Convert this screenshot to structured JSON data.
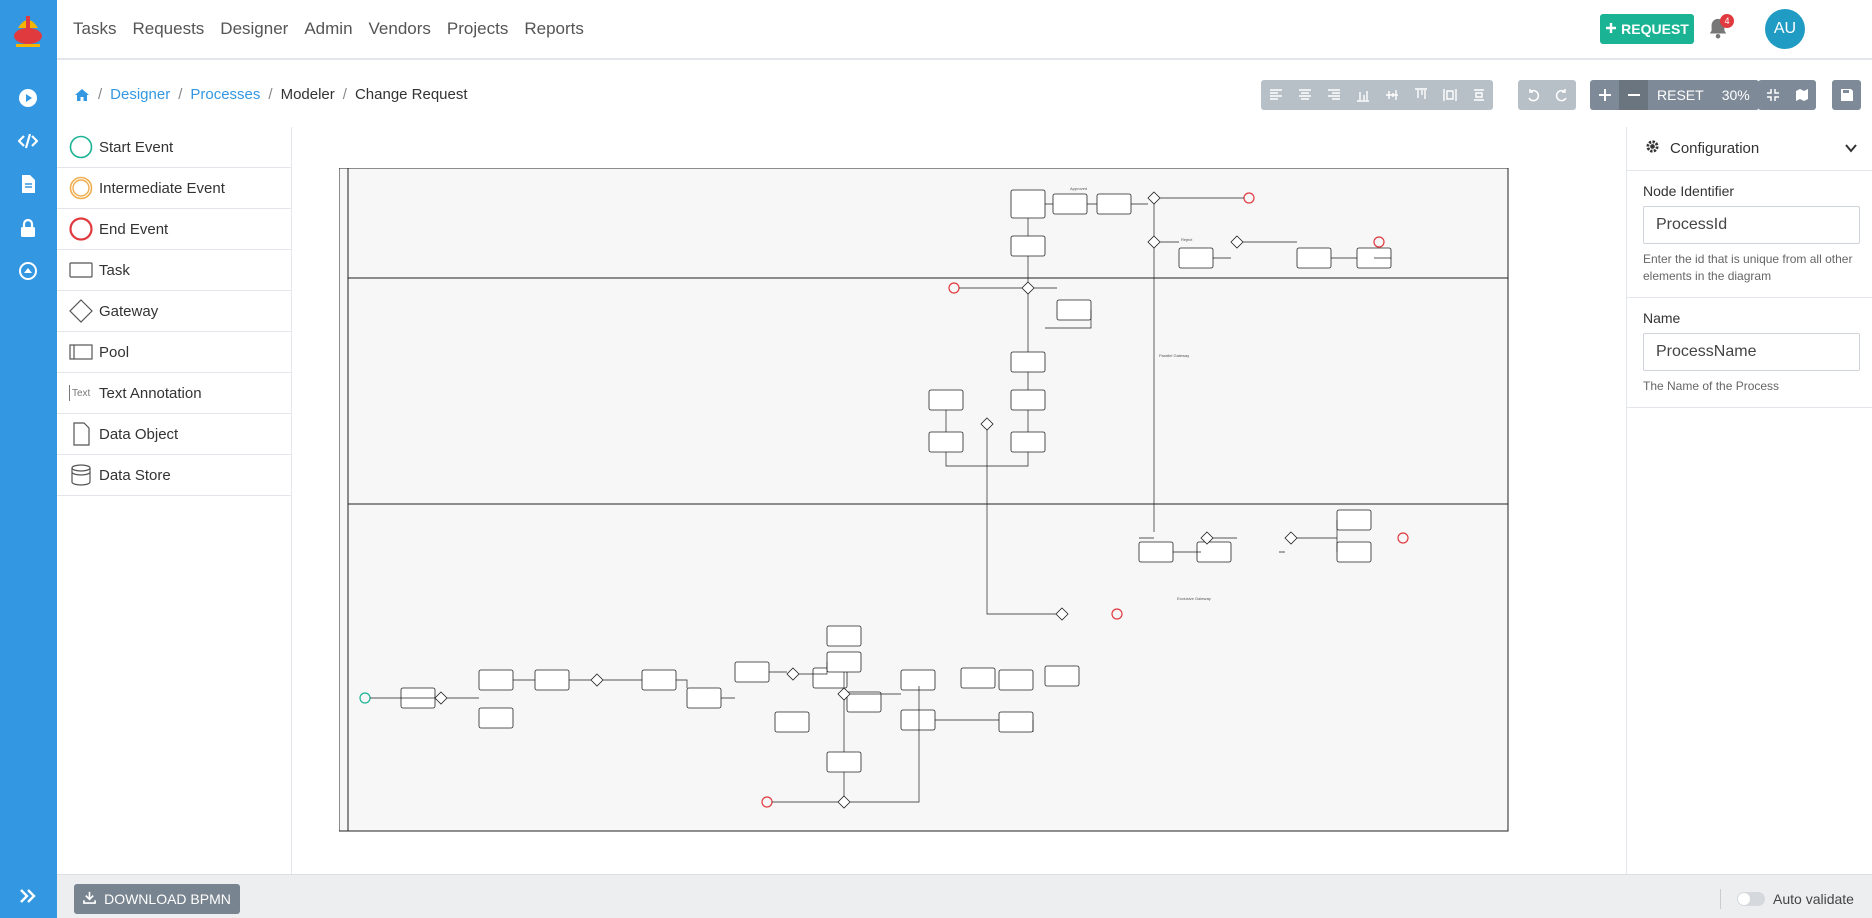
{
  "nav": {
    "items": [
      "Tasks",
      "Requests",
      "Designer",
      "Admin",
      "Vendors",
      "Projects",
      "Reports"
    ],
    "request_label": "REQUEST",
    "notification_count": "4",
    "avatar_initials": "AU"
  },
  "breadcrumb": {
    "items": [
      "Designer",
      "Processes",
      "Modeler",
      "Change Request"
    ]
  },
  "toolbar": {
    "reset_label": "RESET",
    "zoom": "30%"
  },
  "palette": {
    "items": [
      "Start Event",
      "Intermediate Event",
      "End Event",
      "Task",
      "Gateway",
      "Pool",
      "Text Annotation",
      "Data Object",
      "Data Store"
    ],
    "text_annotation_icon_text": "Text"
  },
  "config": {
    "title": "Configuration",
    "node_identifier_label": "Node Identifier",
    "node_identifier_value": "ProcessId",
    "node_identifier_help": "Enter the id that is unique from all other elements in the diagram",
    "name_label": "Name",
    "name_value": "ProcessName",
    "name_help": "The Name of the Process"
  },
  "footer": {
    "download_label": "DOWNLOAD BPMN",
    "auto_validate_label": "Auto validate"
  },
  "colors": {
    "rail": "#3397e2",
    "request": "#1ab394",
    "avatar": "#1f9bc4",
    "start_event": "#1ab394",
    "intermediate_event": "#f0ad4e",
    "end_event": "#e03a3e"
  }
}
